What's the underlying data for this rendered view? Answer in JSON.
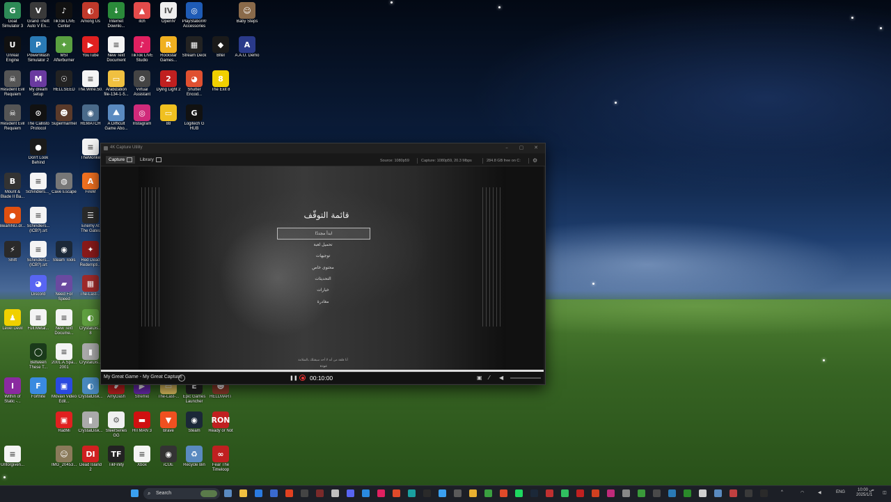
{
  "desktop": {
    "icons": [
      {
        "label": "Goat Simulator 3",
        "color": "#2e8b57",
        "glyph": "G"
      },
      {
        "label": "Grand Theft Auto V En...",
        "color": "#3a3a3a",
        "glyph": "V"
      },
      {
        "label": "TikTok LIVE Center",
        "color": "#111111",
        "glyph": "♪"
      },
      {
        "label": "Among Us",
        "color": "#c0392b",
        "glyph": "◐"
      },
      {
        "label": "Internet Downlo...",
        "color": "#2a8a3a",
        "glyph": "↓"
      },
      {
        "label": "itch",
        "color": "#e44b4b",
        "glyph": "▲"
      },
      {
        "label": "OpenIV",
        "color": "#eeeeee",
        "glyph": "IV"
      },
      {
        "label": "PlayStation® Accessories",
        "color": "#1e5bb5",
        "glyph": "◎"
      },
      {
        "label": "Baby Steps",
        "color": "#8a6a4a",
        "glyph": "☺"
      },
      {
        "label": "Unreal Engine",
        "color": "#111111",
        "glyph": "U"
      },
      {
        "label": "PowerWash Simulator 2",
        "color": "#2a7ab5",
        "glyph": "P"
      },
      {
        "label": "MSI Afterburner",
        "color": "#5aa040",
        "glyph": "✦"
      },
      {
        "label": "YouTube",
        "color": "#e02020",
        "glyph": "▶"
      },
      {
        "label": "New Text Document",
        "color": "#f4f4f4",
        "glyph": "≡"
      },
      {
        "label": "TikTok LIVE Studio",
        "color": "#e02060",
        "glyph": "♪"
      },
      {
        "label": "Rockstar Games...",
        "color": "#f0b020",
        "glyph": "R"
      },
      {
        "label": "Stream Deck",
        "color": "#222222",
        "glyph": "▦"
      },
      {
        "label": "Bltel",
        "color": "#1a1a1a",
        "glyph": "◆"
      },
      {
        "label": "A.A.U. Demo",
        "color": "#2a3a8a",
        "glyph": "A"
      },
      {
        "label": "Resident Evil Requiem",
        "color": "#555555",
        "glyph": "☠"
      },
      {
        "label": "My dream setup",
        "color": "#6a3aa0",
        "glyph": "M"
      },
      {
        "label": "HELLSEED",
        "color": "#222222",
        "glyph": "☉"
      },
      {
        "label": "The.Wine.50...",
        "color": "#f4f4f4",
        "glyph": "≡"
      },
      {
        "label": "Arabization file-134-1-5...",
        "color": "#f0c040",
        "glyph": "▭"
      },
      {
        "label": "Virtual Assistant",
        "color": "#444444",
        "glyph": "⚙"
      },
      {
        "label": "Dying Light 2",
        "color": "#c02020",
        "glyph": "2"
      },
      {
        "label": "Shutter Encod...",
        "color": "#e05030",
        "glyph": "◕"
      },
      {
        "label": "The Exit 8",
        "color": "#f0d000",
        "glyph": "8"
      },
      {
        "label": "Resident Evil Requiem",
        "color": "#555555",
        "glyph": "☠"
      },
      {
        "label": "The Callisto Protocol",
        "color": "#111111",
        "glyph": "⊙"
      },
      {
        "label": "Supermarmel",
        "color": "#5a3a2a",
        "glyph": "☻"
      },
      {
        "label": "REMATCH",
        "color": "#4a6a8a",
        "glyph": "◉"
      },
      {
        "label": "A Difficult Game Abo...",
        "color": "#5a8ac0",
        "glyph": "⛰"
      },
      {
        "label": "Instagram",
        "color": "#d02a7a",
        "glyph": "◎"
      },
      {
        "label": "88",
        "color": "#f0c020",
        "glyph": "▭"
      },
      {
        "label": "Logitech G HUB",
        "color": "#111111",
        "glyph": "G"
      },
      {
        "label": "Don't Look Behind",
        "color": "#1a1a1a",
        "glyph": "●"
      },
      {
        "label": "TheMonke",
        "color": "#f4f4f4",
        "glyph": "≡"
      },
      {
        "label": "Mount & Blade II Ba...",
        "color": "#333333",
        "glyph": "B"
      },
      {
        "label": "Schindlers..._..srt",
        "color": "#f4f4f4",
        "glyph": "≡"
      },
      {
        "label": "Cave Escape",
        "color": "#777777",
        "glyph": "◍"
      },
      {
        "label": "FireM",
        "color": "#f07020",
        "glyph": "A"
      },
      {
        "label": "BeamNG.dr...",
        "color": "#e05010",
        "glyph": "●"
      },
      {
        "label": "Schindlers... (ICB?).srt",
        "color": "#f4f4f4",
        "glyph": "≡"
      },
      {
        "label": "Enemy At The Gates",
        "color": "#2a2a2a",
        "glyph": "☰"
      },
      {
        "label": "Shift",
        "color": "#2a2a2a",
        "glyph": "⚡"
      },
      {
        "label": "Schindlers... (ICB?).srt",
        "color": "#f4f4f4",
        "glyph": "≡"
      },
      {
        "label": "Steam Tools",
        "color": "#1b2838",
        "glyph": "◉"
      },
      {
        "label": "Red Dead Redempti...",
        "color": "#8a1a1a",
        "glyph": "✦"
      },
      {
        "label": "Discord",
        "color": "#5865f2",
        "glyph": "◕"
      },
      {
        "label": "Need For Speed",
        "color": "#6a4aa0",
        "glyph": "▰"
      },
      {
        "label": "The-Last-...",
        "color": "#a02a2a",
        "glyph": "▦"
      },
      {
        "label": "Level Devil",
        "color": "#f0d000",
        "glyph": "♟"
      },
      {
        "label": "Full.Metal...",
        "color": "#f4f4f4",
        "glyph": "≡"
      },
      {
        "label": "New Text Docume...",
        "color": "#f4f4f4",
        "glyph": "≡"
      },
      {
        "label": "CrystalDis... 8",
        "color": "#60a040",
        "glyph": "◐"
      },
      {
        "label": "Between These T...",
        "color": "#1a3a1a",
        "glyph": "◯"
      },
      {
        "label": "2001.A.Spa... 2001",
        "color": "#f4f4f4",
        "glyph": "≡"
      },
      {
        "label": "CrystalDis...",
        "color": "#aaaaaa",
        "glyph": "▮"
      },
      {
        "label": "Within of Static -...",
        "color": "#8a2aa0",
        "glyph": "I"
      },
      {
        "label": "Fortnite",
        "color": "#3a8ae0",
        "glyph": "F"
      },
      {
        "label": "Movavi Video Edit...",
        "color": "#2a4ae0",
        "glyph": "▣"
      },
      {
        "label": "CrystalDisk...",
        "color": "#4a8ac0",
        "glyph": "◐"
      },
      {
        "label": "AmyDash",
        "color": "#c02020",
        "glyph": "❥"
      },
      {
        "label": "Stremio",
        "color": "#6a2ab0",
        "glyph": "▶"
      },
      {
        "label": "The-Last-...",
        "color": "#e0c060",
        "glyph": "▭"
      },
      {
        "label": "Epic Games Launcher",
        "color": "#222222",
        "glyph": "E"
      },
      {
        "label": "HELLMART",
        "color": "#8a3a2a",
        "glyph": "☻"
      },
      {
        "label": "RadMi",
        "color": "#e02020",
        "glyph": "▣"
      },
      {
        "label": "CrystalDisk...",
        "color": "#aaaaaa",
        "glyph": "▮"
      },
      {
        "label": "SteelSeries GG",
        "color": "#f0f0f0",
        "glyph": "⚙"
      },
      {
        "label": "HITMAN 3",
        "color": "#d01010",
        "glyph": "▬"
      },
      {
        "label": "Brave",
        "color": "#f05020",
        "glyph": "▼"
      },
      {
        "label": "Steam",
        "color": "#1b2838",
        "glyph": "◉"
      },
      {
        "label": "Ready or Not",
        "color": "#c02020",
        "glyph": "RON"
      },
      {
        "label": "Unforgiven...",
        "color": "#f4f4f4",
        "glyph": "≡"
      },
      {
        "label": "IMG_20453...",
        "color": "#8a7a5a",
        "glyph": "☺"
      },
      {
        "label": "Dead Island 2",
        "color": "#d02020",
        "glyph": "DI"
      },
      {
        "label": "TikFinity",
        "color": "#222222",
        "glyph": "TF"
      },
      {
        "label": "Xbox",
        "color": "#f4f4f4",
        "glyph": "≡"
      },
      {
        "label": "iCUE",
        "color": "#333333",
        "glyph": "◉"
      },
      {
        "label": "Recycle Bin",
        "color": "#5a8ac0",
        "glyph": "♻"
      },
      {
        "label": "Fear The Timeloop",
        "color": "#c02020",
        "glyph": "∞"
      }
    ]
  },
  "capture_window": {
    "title": "4K Capture Utility",
    "tabs": [
      "Capture",
      "Library"
    ],
    "source": "Source: 1080p59",
    "capture": "Capture: 1080p59, 20.3 Mbps",
    "free_space": "284.8 GB free on C:",
    "recording_name": "My Great Game - My Great Capture",
    "timer": "00:10:00",
    "progress_fraction": 1.0
  },
  "game_menu": {
    "title": "قائمة التوقّف",
    "items": [
      "ابدأ مجددًا",
      "تحميل لعبة",
      "توجيهات",
      "محتوى خاص",
      "التحديثات",
      "خيارات",
      "مغادرة"
    ],
    "selected_index": 0,
    "hint": "أنا قلقة من أنه لا أحد سيقتلك بالسلامة",
    "hint2": "عودة"
  },
  "taskbar": {
    "search_placeholder": "Search",
    "tray_lang": "ENG",
    "tray_time": "ص 10:00",
    "tray_date": "2025/1/1"
  }
}
